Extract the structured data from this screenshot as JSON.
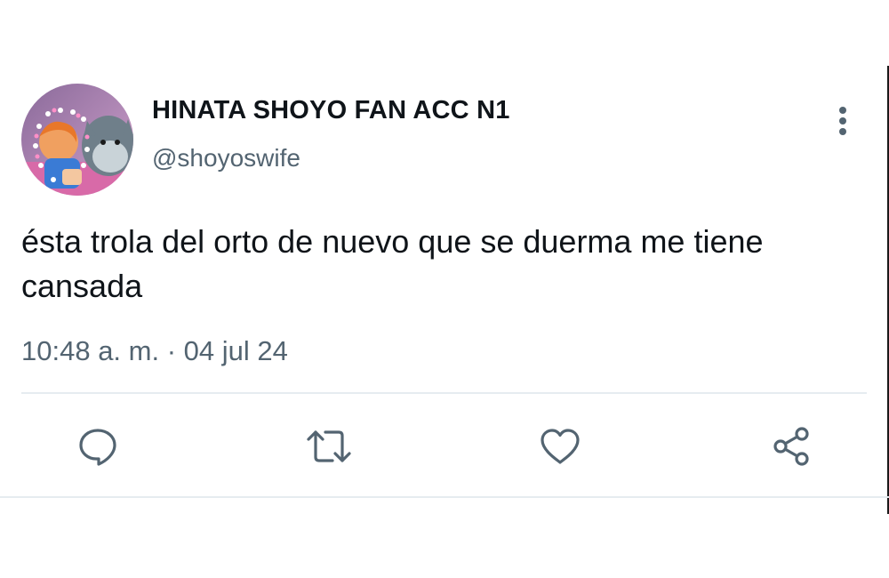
{
  "tweet": {
    "author": {
      "display_name": "HINATA SHOYO FAN ACC N1",
      "handle": "@shoyoswife",
      "avatar_icon": "profile-avatar"
    },
    "text": "ésta trola del orto de nuevo que se duerma me tiene cansada",
    "timestamp": "10:48 a. m. · 04 jul 24"
  },
  "actions": [
    {
      "name": "reply",
      "icon": "reply-icon"
    },
    {
      "name": "retweet",
      "icon": "retweet-icon"
    },
    {
      "name": "like",
      "icon": "heart-icon"
    },
    {
      "name": "share",
      "icon": "share-icon"
    }
  ],
  "colors": {
    "text_primary": "#0f1419",
    "text_secondary": "#536471",
    "divider": "#e6ecf0"
  }
}
